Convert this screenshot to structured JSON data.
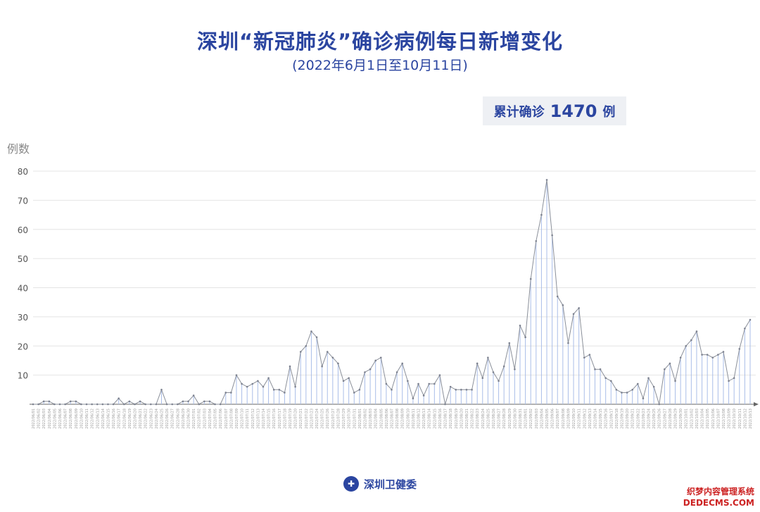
{
  "header": {
    "title": "深圳“新冠肺炎”确诊病例每日新增变化",
    "subtitle": "(2022年6月1日至10月11日)"
  },
  "summary": {
    "label": "累计确诊",
    "value": "1470",
    "unit": "例"
  },
  "footer": {
    "org": "深圳卫健委",
    "logo_icon": "health-commission-emblem-icon"
  },
  "watermark": {
    "line1": "织梦内容管理系统",
    "line2": "DEDECMS.COM"
  },
  "chart_data": {
    "type": "line",
    "title": "深圳“新冠肺炎”确诊病例每日新增变化",
    "subtitle": "(2022年6月1日至10月11日)",
    "ylabel": "例数",
    "xlabel": "",
    "ylim": [
      0,
      80
    ],
    "yticks": [
      10,
      20,
      30,
      40,
      50,
      60,
      70,
      80
    ],
    "grid": true,
    "x_start": "2022-06-01",
    "x_end": "2022-10-11",
    "colors": {
      "line": "#8a8f99",
      "drop": "#a9bde8",
      "grid": "#e4e4e4",
      "accent": "#2b45a0"
    },
    "values": [
      0,
      0,
      1,
      1,
      0,
      0,
      0,
      1,
      1,
      0,
      0,
      0,
      0,
      0,
      0,
      0,
      2,
      0,
      1,
      0,
      1,
      0,
      0,
      0,
      5,
      0,
      0,
      0,
      1,
      1,
      3,
      0,
      1,
      1,
      0,
      0,
      4,
      4,
      10,
      7,
      6,
      7,
      8,
      6,
      9,
      5,
      5,
      4,
      13,
      6,
      18,
      20,
      25,
      23,
      13,
      18,
      16,
      14,
      8,
      9,
      4,
      5,
      11,
      12,
      15,
      16,
      7,
      5,
      11,
      14,
      8,
      2,
      7,
      3,
      7,
      7,
      10,
      0,
      6,
      5,
      5,
      5,
      5,
      14,
      9,
      16,
      11,
      8,
      13,
      21,
      12,
      27,
      23,
      43,
      56,
      65,
      77,
      58,
      37,
      34,
      21,
      31,
      33,
      16,
      17,
      12,
      12,
      9,
      8,
      5,
      4,
      4,
      5,
      7,
      2,
      9,
      6,
      0,
      12,
      14,
      8,
      16,
      20,
      22,
      25,
      17,
      17,
      16,
      17,
      18,
      8,
      9,
      19,
      26,
      29
    ]
  }
}
